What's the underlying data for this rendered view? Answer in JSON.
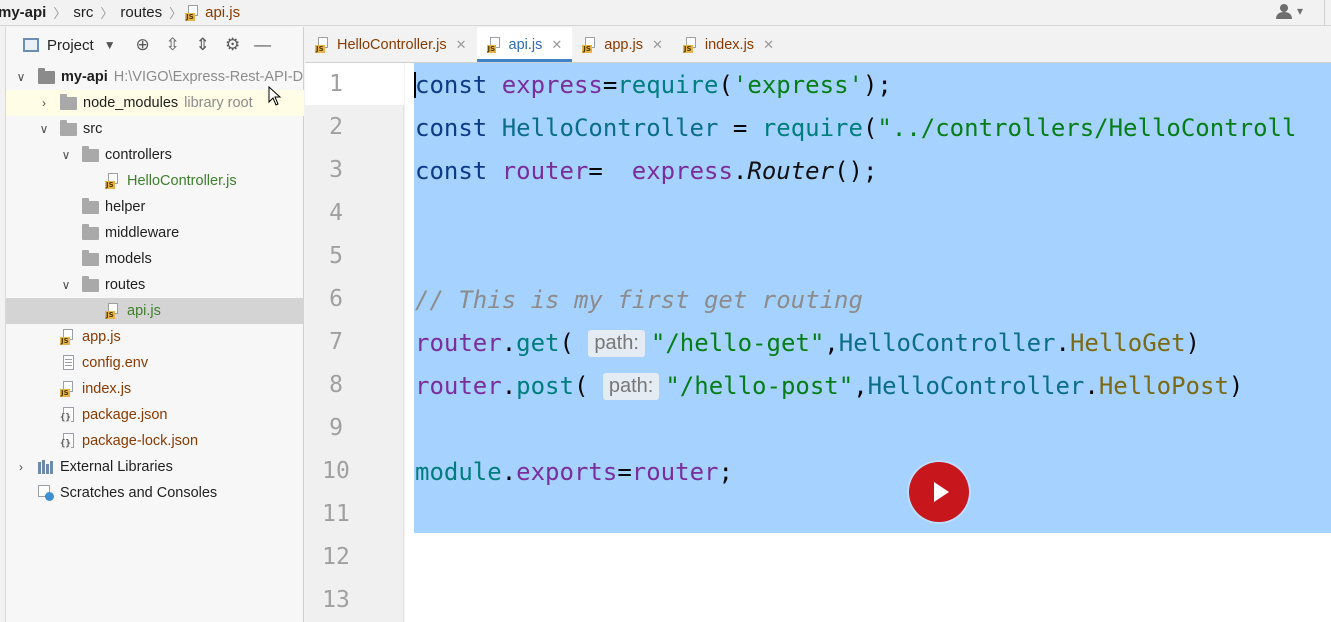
{
  "breadcrumb": {
    "items": [
      {
        "label": "my-api"
      },
      {
        "label": "src"
      },
      {
        "label": "routes"
      },
      {
        "label": "api.js"
      }
    ]
  },
  "project_panel": {
    "title": "Project",
    "toolbar_icons": [
      "crosshair-icon",
      "expand-all-icon",
      "collapse-all-icon",
      "settings-icon",
      "minimize-icon"
    ]
  },
  "tree": {
    "root": {
      "label": "my-api",
      "path": "H:\\VIGO\\Express-Rest-API-D"
    },
    "node_modules": {
      "label": "node_modules",
      "hint": "library root"
    },
    "src": {
      "label": "src"
    },
    "controllers": {
      "label": "controllers"
    },
    "hello_controller": {
      "label": "HelloController.js"
    },
    "helper": {
      "label": "helper"
    },
    "middleware": {
      "label": "middleware"
    },
    "models": {
      "label": "models"
    },
    "routes": {
      "label": "routes"
    },
    "api": {
      "label": "api.js"
    },
    "app": {
      "label": "app.js"
    },
    "config": {
      "label": "config.env"
    },
    "index": {
      "label": "index.js"
    },
    "package": {
      "label": "package.json"
    },
    "package_lock": {
      "label": "package-lock.json"
    },
    "external": {
      "label": "External Libraries"
    },
    "scratches": {
      "label": "Scratches and Consoles"
    }
  },
  "tabs": [
    {
      "label": "HelloController.js",
      "active": false
    },
    {
      "label": "api.js",
      "active": true
    },
    {
      "label": "app.js",
      "active": false
    },
    {
      "label": "index.js",
      "active": false
    }
  ],
  "editor": {
    "line_numbers": [
      "1",
      "2",
      "3",
      "4",
      "5",
      "6",
      "7",
      "8",
      "9",
      "10",
      "11",
      "12",
      "13"
    ],
    "lines": {
      "l1": {
        "kw": "const",
        "var": "express",
        "op": "=",
        "fn": "require",
        "p1": "(",
        "str": "'express'",
        "p2": ");"
      },
      "l2": {
        "kw": "const",
        "cls": "HelloController",
        "op": " = ",
        "fn": "require",
        "p1": "(",
        "str": "\"../controllers/HelloControll"
      },
      "l3": {
        "kw": "const",
        "var": "router",
        "op": "=  ",
        "obj": "express",
        "dot": ".",
        "it": "Router",
        "p": "();"
      },
      "l6": {
        "comment": "// This is my first get routing"
      },
      "l7": {
        "obj": "router",
        "dot": ".",
        "fn": "get",
        "p1": "(",
        "hint": "path:",
        "str": "\"/hello-get\"",
        "comma": ",",
        "cls": "HelloController",
        "dot2": ".",
        "prop": "HelloGet",
        "p2": ")"
      },
      "l8": {
        "obj": "router",
        "dot": ".",
        "fn": "post",
        "p1": "(",
        "hint": "path:",
        "str": "\"/hello-post\"",
        "comma": ",",
        "cls": "HelloController",
        "dot2": ".",
        "prop": "HelloPost",
        "p2": ")"
      },
      "l10": {
        "obj": "module",
        "dot": ".",
        "prop": "exports",
        "op": "=",
        "var": "router",
        "end": ";"
      }
    }
  },
  "colors": {
    "selection": "#a6d2ff",
    "play_button": "#c8161d",
    "active_tab_accent": "#4083c9"
  }
}
